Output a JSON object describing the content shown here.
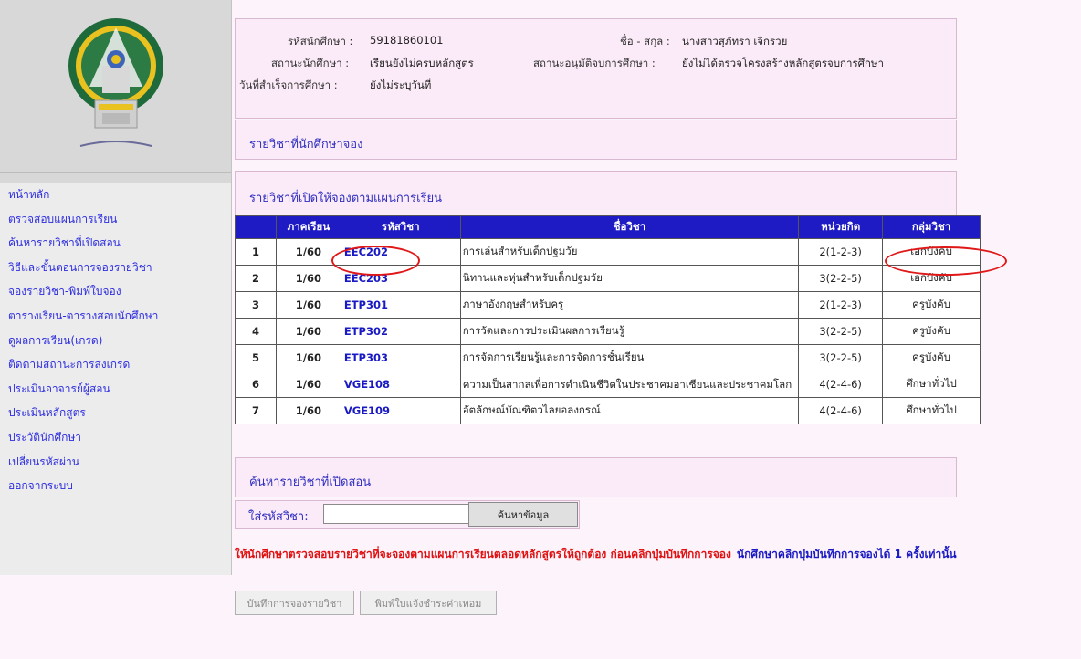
{
  "sidebar": {
    "items": [
      {
        "label": "หน้าหลัก"
      },
      {
        "label": "ตรวจสอบแผนการเรียน"
      },
      {
        "label": "ค้นหารายวิชาที่เปิดสอน"
      },
      {
        "label": "วิธีและขั้นตอนการจองรายวิชา"
      },
      {
        "label": "จองรายวิชา-พิมพ์ใบจอง"
      },
      {
        "label": "ตารางเรียน-ตารางสอบนักศึกษา"
      },
      {
        "label": "ดูผลการเรียน(เกรด)"
      },
      {
        "label": "ติดตามสถานะการส่งเกรด"
      },
      {
        "label": "ประเมินอาจารย์ผู้สอน"
      },
      {
        "label": "ประเมินหลักสูตร"
      },
      {
        "label": "ประวัตินักศึกษา"
      },
      {
        "label": "เปลี่ยนรหัสผ่าน"
      },
      {
        "label": "ออกจากระบบ"
      }
    ]
  },
  "student": {
    "id_label": "รหัสนักศึกษา :",
    "id": "59181860101",
    "name_label": "ชื่อ - สกุล :",
    "name": "นางสาวสุภัทรา เจิกรวย",
    "status_label": "สถานะนักศึกษา :",
    "status": "เรียนยังไม่ครบหลักสูตร",
    "approval_label": "สถานะอนุมัติจบการศึกษา :",
    "approval": "ยังไม่ได้ตรวจโครงสร้างหลักสูตรจบการศึกษา",
    "grad_label": "วันที่สำเร็จการศึกษา :",
    "grad": "ยังไม่ระบุวันที่"
  },
  "reserved_title": "รายวิชาที่นักศึกษาจอง",
  "open_title": "รายวิชาที่เปิดให้จองตามแผนการเรียน",
  "table": {
    "headers": [
      "",
      "ภาคเรียน",
      "รหัสวิชา",
      "ชื่อวิชา",
      "หน่วยกิต",
      "กลุ่มวิชา"
    ],
    "rows": [
      {
        "no": "1",
        "term": "1/60",
        "code": "EEC202",
        "name": "การเล่นสำหรับเด็กปฐมวัย",
        "credit": "2(1-2-3)",
        "group": "เอกบังคับ"
      },
      {
        "no": "2",
        "term": "1/60",
        "code": "EEC203",
        "name": "นิทานและหุ่นสำหรับเด็กปฐมวัย",
        "credit": "3(2-2-5)",
        "group": "เอกบังคับ"
      },
      {
        "no": "3",
        "term": "1/60",
        "code": "ETP301",
        "name": "ภาษาอังกฤษสำหรับครู",
        "credit": "2(1-2-3)",
        "group": "ครูบังคับ"
      },
      {
        "no": "4",
        "term": "1/60",
        "code": "ETP302",
        "name": "การวัดและการประเมินผลการเรียนรู้",
        "credit": "3(2-2-5)",
        "group": "ครูบังคับ"
      },
      {
        "no": "5",
        "term": "1/60",
        "code": "ETP303",
        "name": "การจัดการเรียนรู้และการจัดการชั้นเรียน",
        "credit": "3(2-2-5)",
        "group": "ครูบังคับ"
      },
      {
        "no": "6",
        "term": "1/60",
        "code": "VGE108",
        "name": "ความเป็นสากลเพื่อการดำเนินชีวิตในประชาคมอาเซียนและประชาคมโลก",
        "credit": "4(2-4-6)",
        "group": "ศึกษาทั่วไป"
      },
      {
        "no": "7",
        "term": "1/60",
        "code": "VGE109",
        "name": "อัตลักษณ์บัณฑิตวไลยอลงกรณ์",
        "credit": "4(2-4-6)",
        "group": "ศึกษาทั่วไป"
      }
    ]
  },
  "search": {
    "title": "ค้นหารายวิชาที่เปิดสอน",
    "label": "ใส่รหัสวิชา:",
    "value": "",
    "button": "ค้นหาข้อมูล"
  },
  "warning": {
    "red": "ให้นักศึกษาตรวจสอบรายวิชาที่จะจองตามแผนการเรียนตลอดหลักสูตรให้ถูกต้อง ก่อนคลิกปุ่มบันทึกการจอง",
    "blue": "นักศึกษาคลิกปุ่มบันทึกการจองได้ 1 ครั้งเท่านั้น"
  },
  "buttons": {
    "save": "บันทึกการจองรายวิชา",
    "print": "พิมพ์ใบแจ้งชำระค่าเทอม"
  },
  "colors": {
    "accent": "#1e1ac4",
    "highlight": "#e01818",
    "panel": "#fbeaf7"
  }
}
